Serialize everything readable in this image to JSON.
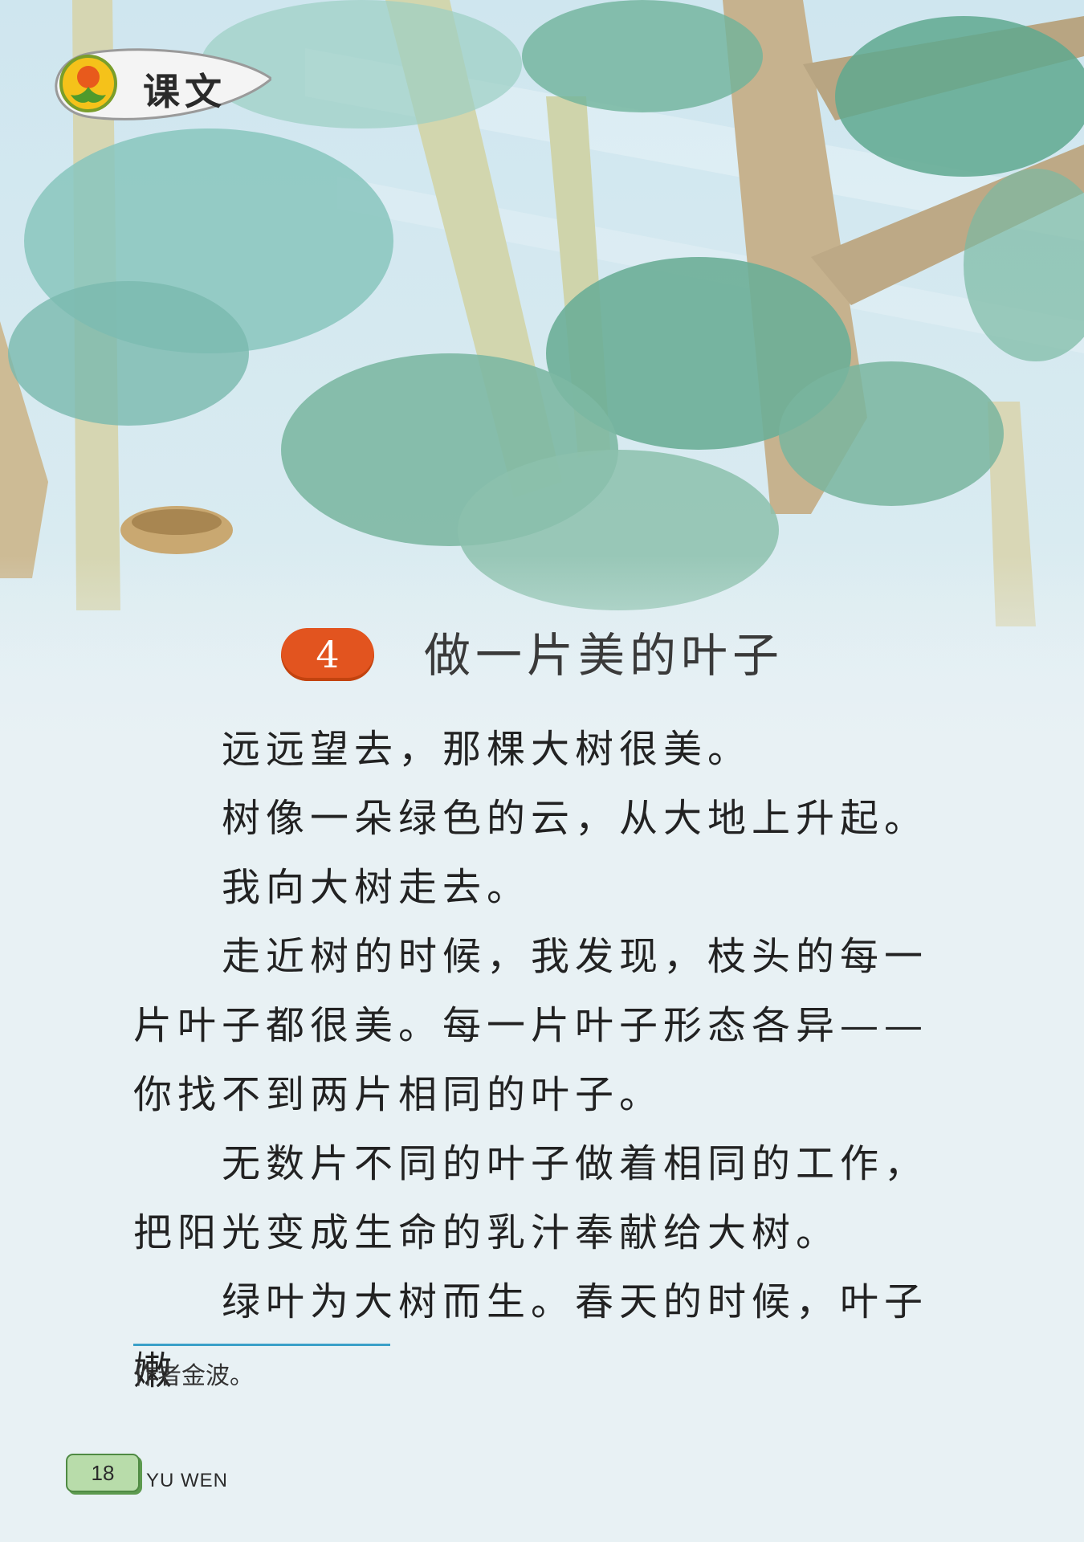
{
  "section": {
    "label": "课文",
    "icon": "logo-icon"
  },
  "lesson": {
    "number": "4",
    "title": "做一片美的叶子"
  },
  "body": {
    "paragraphs": [
      "远远望去，那棵大树很美。",
      "树像一朵绿色的云，从大地上升起。",
      "我向大树走去。",
      "走近树的时候，我发现，枝头的每一片叶子都很美。每一片叶子形态各异——你找不到两片相同的叶子。",
      "无数片不同的叶子做着相同的工作，把阳光变成生命的乳汁奉献给大树。",
      "绿叶为大树而生。春天的时候，叶子嫩"
    ]
  },
  "footnote": "作者金波。",
  "footer": {
    "page_number": "18",
    "book_label": "YU WEN"
  },
  "colors": {
    "accent": "#e2541f",
    "rule": "#3aa0c8",
    "page_tab": "#b8dcaa"
  }
}
